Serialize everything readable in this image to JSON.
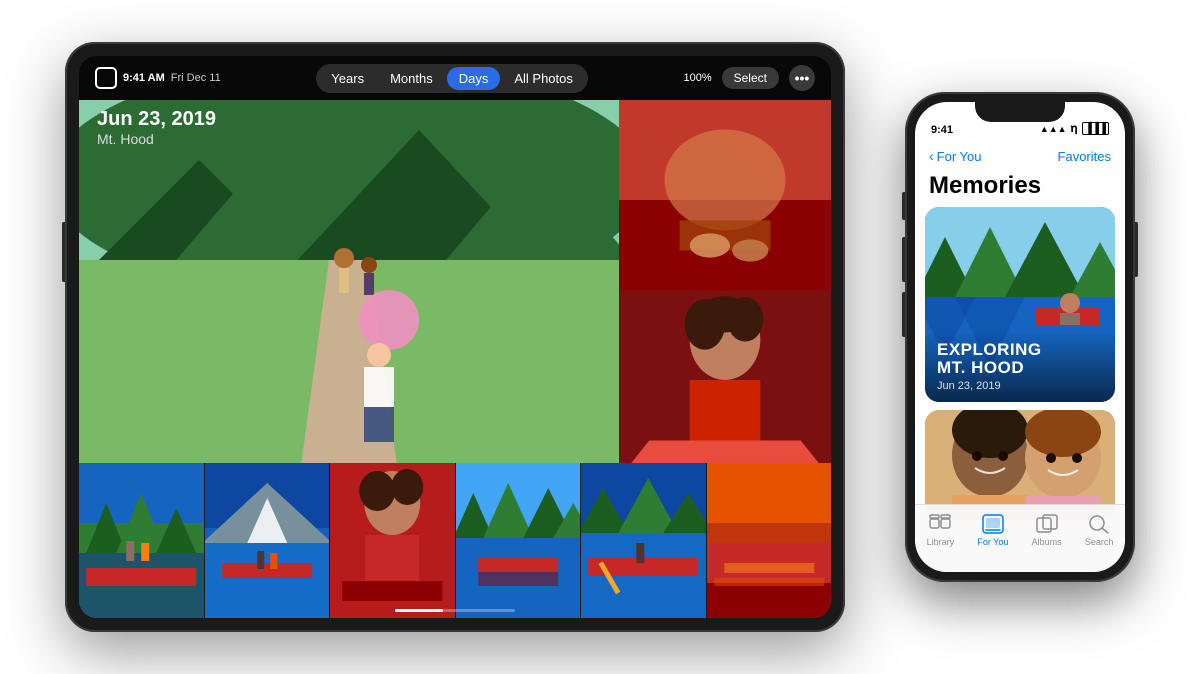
{
  "scene": {
    "background": "#ffffff"
  },
  "ipad": {
    "statusbar": {
      "time": "9:41 AM",
      "date": "Fri Dec 11",
      "battery": "100%"
    },
    "tabs": [
      {
        "label": "Years",
        "active": false
      },
      {
        "label": "Months",
        "active": false
      },
      {
        "label": "Days",
        "active": true
      },
      {
        "label": "All Photos",
        "active": false
      }
    ],
    "select_label": "Select",
    "more_icon": "•••",
    "date_label": "Jun 23, 2019",
    "location_label": "Mt. Hood",
    "progress_fill": "40%"
  },
  "iphone": {
    "statusbar": {
      "time": "9:41",
      "signal": "▲▲▲",
      "wifi": "WiFi",
      "battery": "100%"
    },
    "navbar": {
      "back_label": "For You",
      "favorites_label": "Favorites"
    },
    "title": "Memories",
    "memory1": {
      "title": "EXPLORING\nMT. HOOD",
      "date": "Jun 23, 2019"
    },
    "tabbar": {
      "items": [
        {
          "label": "Library",
          "icon": "⊞",
          "active": false
        },
        {
          "label": "For You",
          "icon": "♡",
          "active": true
        },
        {
          "label": "Albums",
          "icon": "⬜",
          "active": false
        },
        {
          "label": "Search",
          "icon": "⌕",
          "active": false
        }
      ]
    }
  }
}
